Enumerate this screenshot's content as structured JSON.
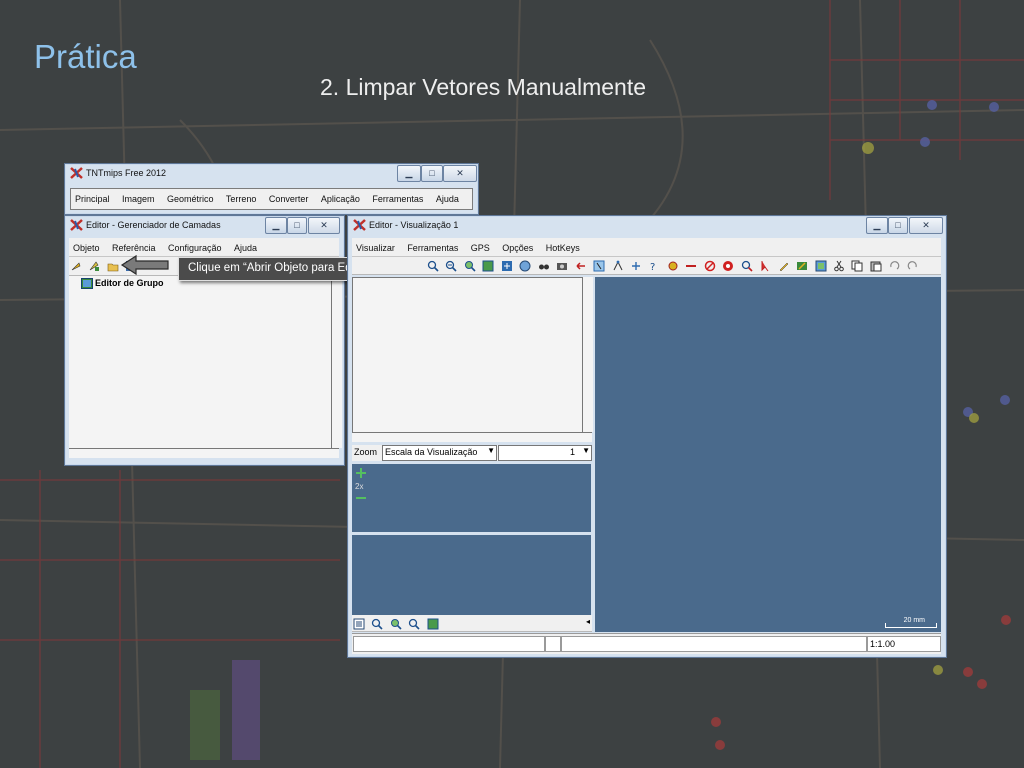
{
  "slide": {
    "title": "Prática",
    "subtitle": "2. Limpar Vetores Manualmente"
  },
  "main_window": {
    "title": "TNTmips Free 2012",
    "menu": [
      "Principal",
      "Imagem",
      "Geométrico",
      "Terreno",
      "Converter",
      "Aplicação",
      "Ferramentas",
      "Ajuda"
    ]
  },
  "layer_manager": {
    "title": "Editor - Gerenciador de Camadas",
    "menu": [
      "Objeto",
      "Referência",
      "Configuração",
      "Ajuda"
    ],
    "tree_item": "Editor de Grupo"
  },
  "tooltip": {
    "text": "Clique em “Abrir Objeto para Editar...”."
  },
  "view_window": {
    "title": "Editor - Visualização 1",
    "menu": [
      "Visualizar",
      "Ferramentas",
      "GPS",
      "Opções",
      "HotKeys"
    ],
    "zoom_label": "Zoom",
    "zoom_select": "Escala da Visualização",
    "zoom_value": "1",
    "zoom_factor": "2x",
    "scale_bar_label": "20 mm",
    "scale_value": "1:1.00"
  },
  "colors": {
    "map_panel": "#4a6a8c",
    "slide_title": "#8ec1ea",
    "tooltip_bg": "#4b4b4b"
  },
  "icons": [
    "window-close-icon",
    "window-minimize-icon",
    "window-maximize-icon",
    "open-object-icon",
    "zoom-in-icon",
    "zoom-out-icon",
    "pan-icon",
    "undo-icon",
    "redo-icon"
  ]
}
